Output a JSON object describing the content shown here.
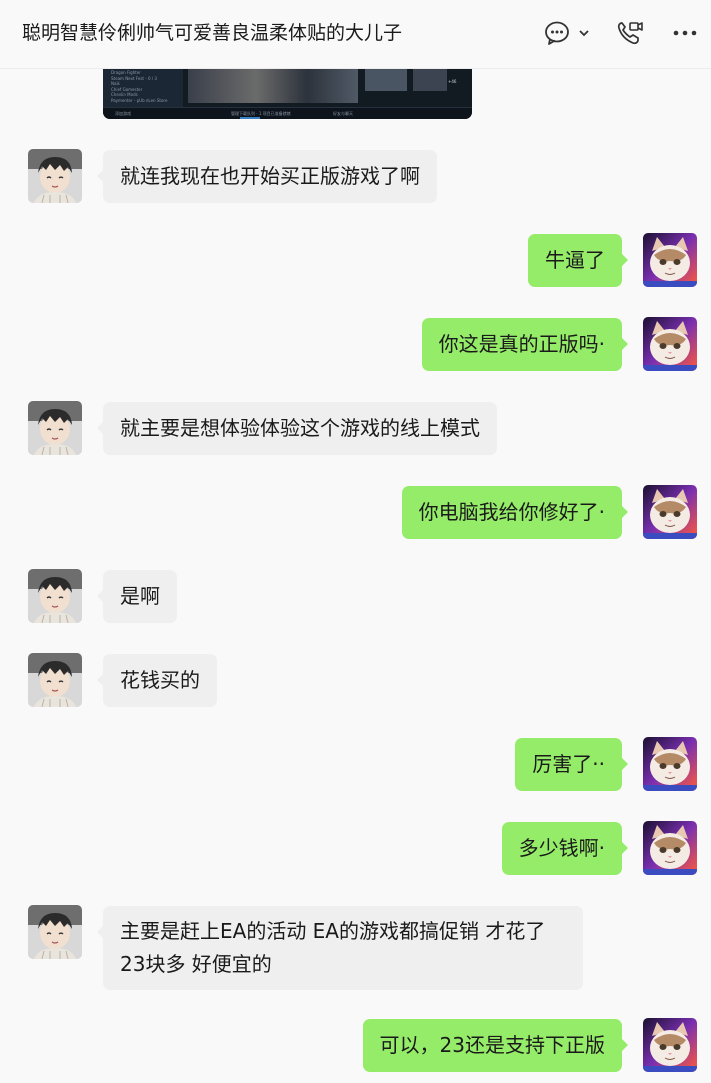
{
  "header": {
    "title": "聪明智慧伶俐帅气可爱善良温柔体贴的大儿子",
    "icons": [
      "chat-bubble-icon",
      "chevron-down-icon",
      "video-call-icon",
      "more-icon"
    ]
  },
  "colors": {
    "self_bubble": "#95ec69",
    "other_bubble": "#efeff0",
    "background": "#f9f9f9"
  },
  "shared_screenshot": {
    "menu": [
      "Dragon Fighter",
      "Steam Next Fest - 0 / 3",
      "Naik",
      "Chief Gamester",
      "Chevlin Mods",
      "Paymenter - pUb nLen Store"
    ],
    "footer_left": "添加游戏",
    "footer_center": "管理下载队列 · 1 项目已准备就绪",
    "footer_mid": "好友与聊天",
    "badge": "+46"
  },
  "messages": [
    {
      "from": "other",
      "text": "就连我现在也开始买正版游戏了啊"
    },
    {
      "from": "self",
      "text": "牛逼了"
    },
    {
      "from": "self",
      "text": "你这是真的正版吗·"
    },
    {
      "from": "other",
      "text": "就主要是想体验体验这个游戏的线上模式"
    },
    {
      "from": "self",
      "text": "你电脑我给你修好了·"
    },
    {
      "from": "other",
      "text": "是啊"
    },
    {
      "from": "other",
      "text": "花钱买的"
    },
    {
      "from": "self",
      "text": "厉害了··"
    },
    {
      "from": "self",
      "text": "多少钱啊·"
    },
    {
      "from": "other",
      "text": "主要是赶上EA的活动 EA的游戏都搞促销 才花了23块多 好便宜的"
    },
    {
      "from": "self",
      "text": "可以，23还是支持下正版"
    }
  ]
}
